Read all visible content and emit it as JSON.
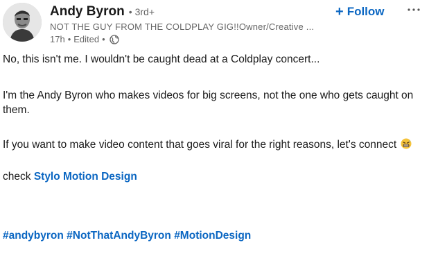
{
  "author": {
    "name": "Andy Byron",
    "degree": "3rd+",
    "headline": "NOT THE GUY FROM THE COLDPLAY GIG!!Owner/Creative ...",
    "time": "17h",
    "edited": "Edited",
    "visibility_icon": "globe-icon"
  },
  "actions": {
    "follow_label": "Follow",
    "follow_icon": "plus-icon",
    "more_icon": "ellipsis-icon"
  },
  "body": {
    "p1": "No, this isn't me. I wouldn't be caught dead at a Coldplay concert...",
    "p2": "I'm the Andy Byron who makes videos for big screens, not the one who gets caught on them.",
    "p3": "If you want to make video content that goes viral for the right reasons, let's connect",
    "p3_emoji": "grimacing-sweat-emoji",
    "p4_prefix": "check",
    "p4_link": "Stylo Motion Design"
  },
  "hashtags": [
    "#andybyron",
    "#NotThatAndyByron",
    "#MotionDesign"
  ],
  "colors": {
    "accent": "#0a66c2",
    "text": "#191919",
    "muted": "#666666"
  }
}
